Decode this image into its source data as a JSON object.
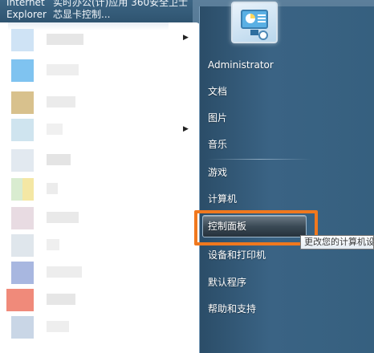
{
  "desktop": {
    "icon_label_line1": "Internet",
    "icon_label_line2": "Explorer",
    "program_label_line1": "实时办公(计)应用  360安全卫士",
    "program_label_line2": "芯显卡控制..."
  },
  "right_panel": {
    "user_name": "Administrator",
    "items": [
      {
        "label": "文档"
      },
      {
        "label": "图片"
      },
      {
        "label": "音乐"
      },
      {
        "label": "游戏"
      },
      {
        "label": "计算机"
      },
      {
        "label": "控制面板"
      },
      {
        "label": "设备和打印机"
      },
      {
        "label": "默认程序"
      },
      {
        "label": "帮助和支持"
      }
    ]
  },
  "tooltip": {
    "text": "更改您的计算机设置"
  },
  "colors": {
    "highlight_border": "#f0781e",
    "panel_dark": "#2b4d68"
  }
}
